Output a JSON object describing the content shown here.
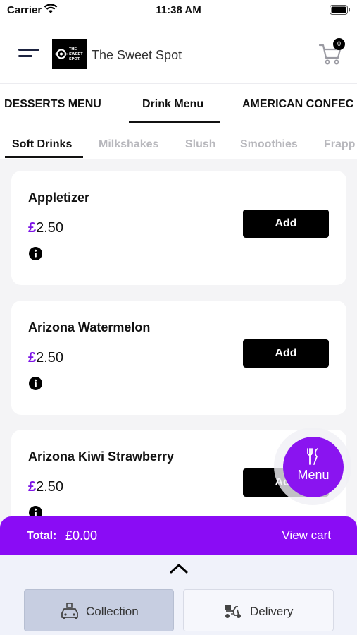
{
  "status_bar": {
    "carrier": "Carrier",
    "time": "11:38 AM"
  },
  "header": {
    "store_name": "The Sweet Spot",
    "logo_text": "THE SWEET SPOT",
    "cart_count": "0"
  },
  "category_tabs": [
    {
      "label": "DESSERTS MENU"
    },
    {
      "label": "Drink Menu",
      "active": true
    },
    {
      "label": "AMERICAN CONFEC"
    }
  ],
  "sub_tabs": [
    {
      "label": "Soft Drinks",
      "active": true
    },
    {
      "label": "Milkshakes"
    },
    {
      "label": "Slush"
    },
    {
      "label": "Smoothies"
    },
    {
      "label": "Frapp"
    }
  ],
  "products": [
    {
      "name": "Appletizer",
      "currency": "£",
      "price": "2.50",
      "add_label": "Add"
    },
    {
      "name": "Arizona Watermelon",
      "currency": "£",
      "price": "2.50",
      "add_label": "Add"
    },
    {
      "name": "Arizona Kiwi Strawberry",
      "currency": "£",
      "price": "2.50",
      "add_label": "Add"
    }
  ],
  "fab": {
    "label": "Menu",
    "icon": "fork-spoon-icon"
  },
  "total_bar": {
    "label": "Total:",
    "value": "£0.00",
    "view_cart": "View cart"
  },
  "order_options": [
    {
      "label": "Collection",
      "icon": "collection-car-icon",
      "selected": true
    },
    {
      "label": "Delivery",
      "icon": "delivery-scooter-icon"
    }
  ],
  "colors": {
    "accent": "#8a0cf5",
    "price_symbol": "#7d14e6",
    "add_button": "#000000"
  }
}
